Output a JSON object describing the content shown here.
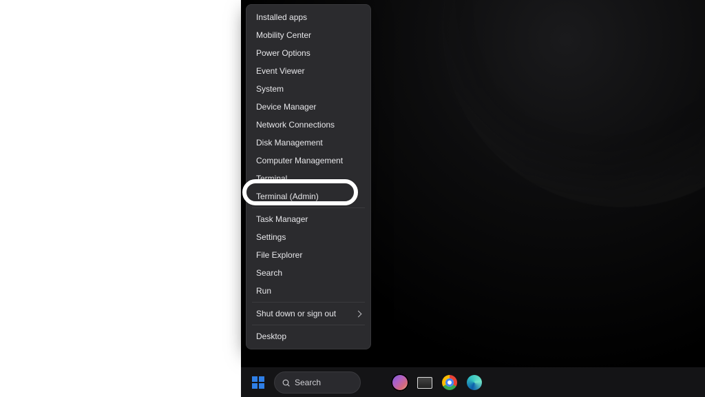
{
  "menu": {
    "items": [
      {
        "label": "Installed apps",
        "sepBefore": false,
        "submenu": false
      },
      {
        "label": "Mobility Center",
        "sepBefore": false,
        "submenu": false
      },
      {
        "label": "Power Options",
        "sepBefore": false,
        "submenu": false
      },
      {
        "label": "Event Viewer",
        "sepBefore": false,
        "submenu": false
      },
      {
        "label": "System",
        "sepBefore": false,
        "submenu": false
      },
      {
        "label": "Device Manager",
        "sepBefore": false,
        "submenu": false
      },
      {
        "label": "Network Connections",
        "sepBefore": false,
        "submenu": false
      },
      {
        "label": "Disk Management",
        "sepBefore": false,
        "submenu": false
      },
      {
        "label": "Computer Management",
        "sepBefore": false,
        "submenu": false
      },
      {
        "label": "Terminal",
        "sepBefore": false,
        "submenu": false
      },
      {
        "label": "Terminal (Admin)",
        "sepBefore": false,
        "submenu": false
      },
      {
        "label": "Task Manager",
        "sepBefore": true,
        "submenu": false
      },
      {
        "label": "Settings",
        "sepBefore": false,
        "submenu": false
      },
      {
        "label": "File Explorer",
        "sepBefore": false,
        "submenu": false
      },
      {
        "label": "Search",
        "sepBefore": false,
        "submenu": false
      },
      {
        "label": "Run",
        "sepBefore": false,
        "submenu": false
      },
      {
        "label": "Shut down or sign out",
        "sepBefore": true,
        "submenu": true
      },
      {
        "label": "Desktop",
        "sepBefore": true,
        "submenu": false
      }
    ],
    "highlightedLabel": "Terminal (Admin)"
  },
  "taskbar": {
    "search_placeholder": "Search"
  }
}
